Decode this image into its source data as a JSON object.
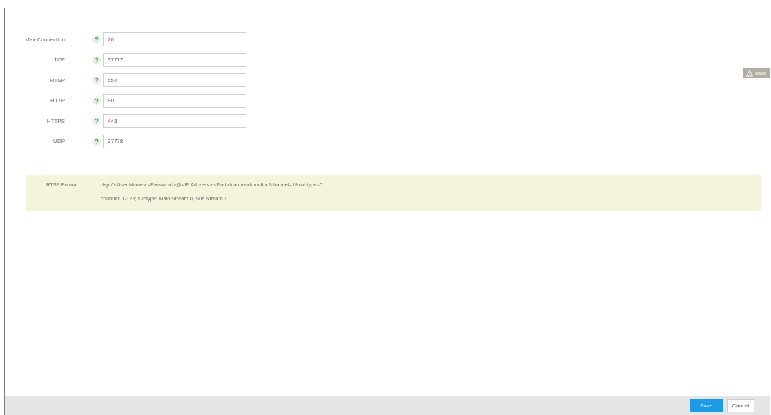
{
  "form": {
    "fields": [
      {
        "label": "Max Connection",
        "value": "20"
      },
      {
        "label": "TCP",
        "value": "37777"
      },
      {
        "label": "RTSP",
        "value": "554"
      },
      {
        "label": "HTTP",
        "value": "80"
      },
      {
        "label": "HTTPS",
        "value": "443"
      },
      {
        "label": "UDP",
        "value": "37778"
      }
    ]
  },
  "rtsp_info": {
    "label": "RTSP Format",
    "lines": [
      "rtsp://<User Name>:<Password>@<IP Address>:<Port>/cam/realmonitor?channel=1&subtype=0",
      "channel: 1-128; subtype: Main Stream 0, Sub Stream 1."
    ]
  },
  "footer": {
    "buttons": [
      {
        "label": "Save",
        "kind": "primary"
      },
      {
        "label": "Cancel",
        "kind": "secondary"
      }
    ]
  }
}
